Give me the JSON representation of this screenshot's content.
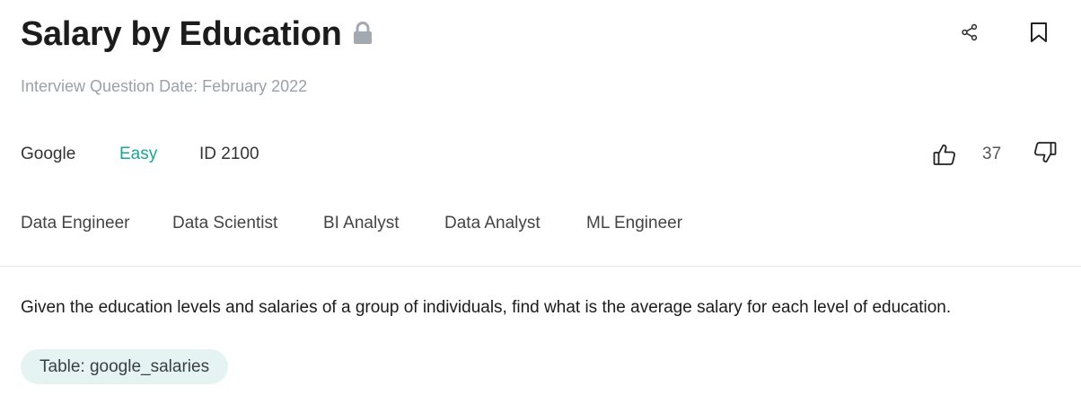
{
  "question": {
    "title": "Salary by Education",
    "date_text": "Interview Question Date: February 2022",
    "company": "Google",
    "difficulty": "Easy",
    "id_text": "ID 2100",
    "votes": "37",
    "roles": [
      "Data Engineer",
      "Data Scientist",
      "BI Analyst",
      "Data Analyst",
      "ML Engineer"
    ],
    "description": "Given the education levels and salaries of a group of individuals, find what is the average salary for each level of education.",
    "table_label": "Table: google_salaries"
  },
  "icons": {
    "lock": "lock-icon",
    "share": "share-icon",
    "bookmark": "bookmark-icon",
    "thumb_up": "thumbs-up-icon",
    "thumb_down": "thumbs-down-icon"
  },
  "colors": {
    "difficulty_easy": "#1aa59a",
    "chip_background": "#e5f4f2",
    "muted_text": "#9aa1a8",
    "lock_gray": "#a3a9b0"
  }
}
